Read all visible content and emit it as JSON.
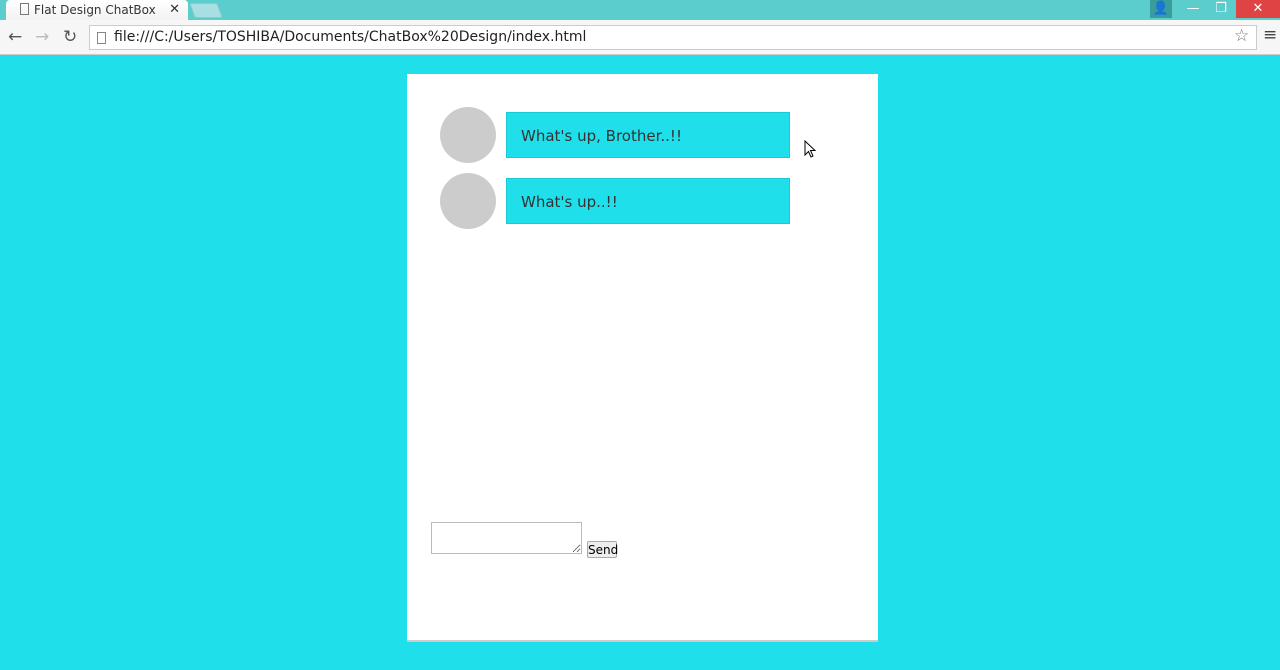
{
  "browser": {
    "tab_title": "Flat Design ChatBox",
    "url": "file:///C:/Users/TOSHIBA/Documents/ChatBox%20Design/index.html"
  },
  "chat": {
    "messages": [
      {
        "text": "What's up, Brother..!!"
      },
      {
        "text": "What's up..!!"
      }
    ],
    "input": {
      "value": "",
      "placeholder": ""
    },
    "send_label": "Send"
  },
  "colors": {
    "background": "#1fdfea",
    "bubble": "#1fdfea",
    "avatar": "#cccccc"
  }
}
